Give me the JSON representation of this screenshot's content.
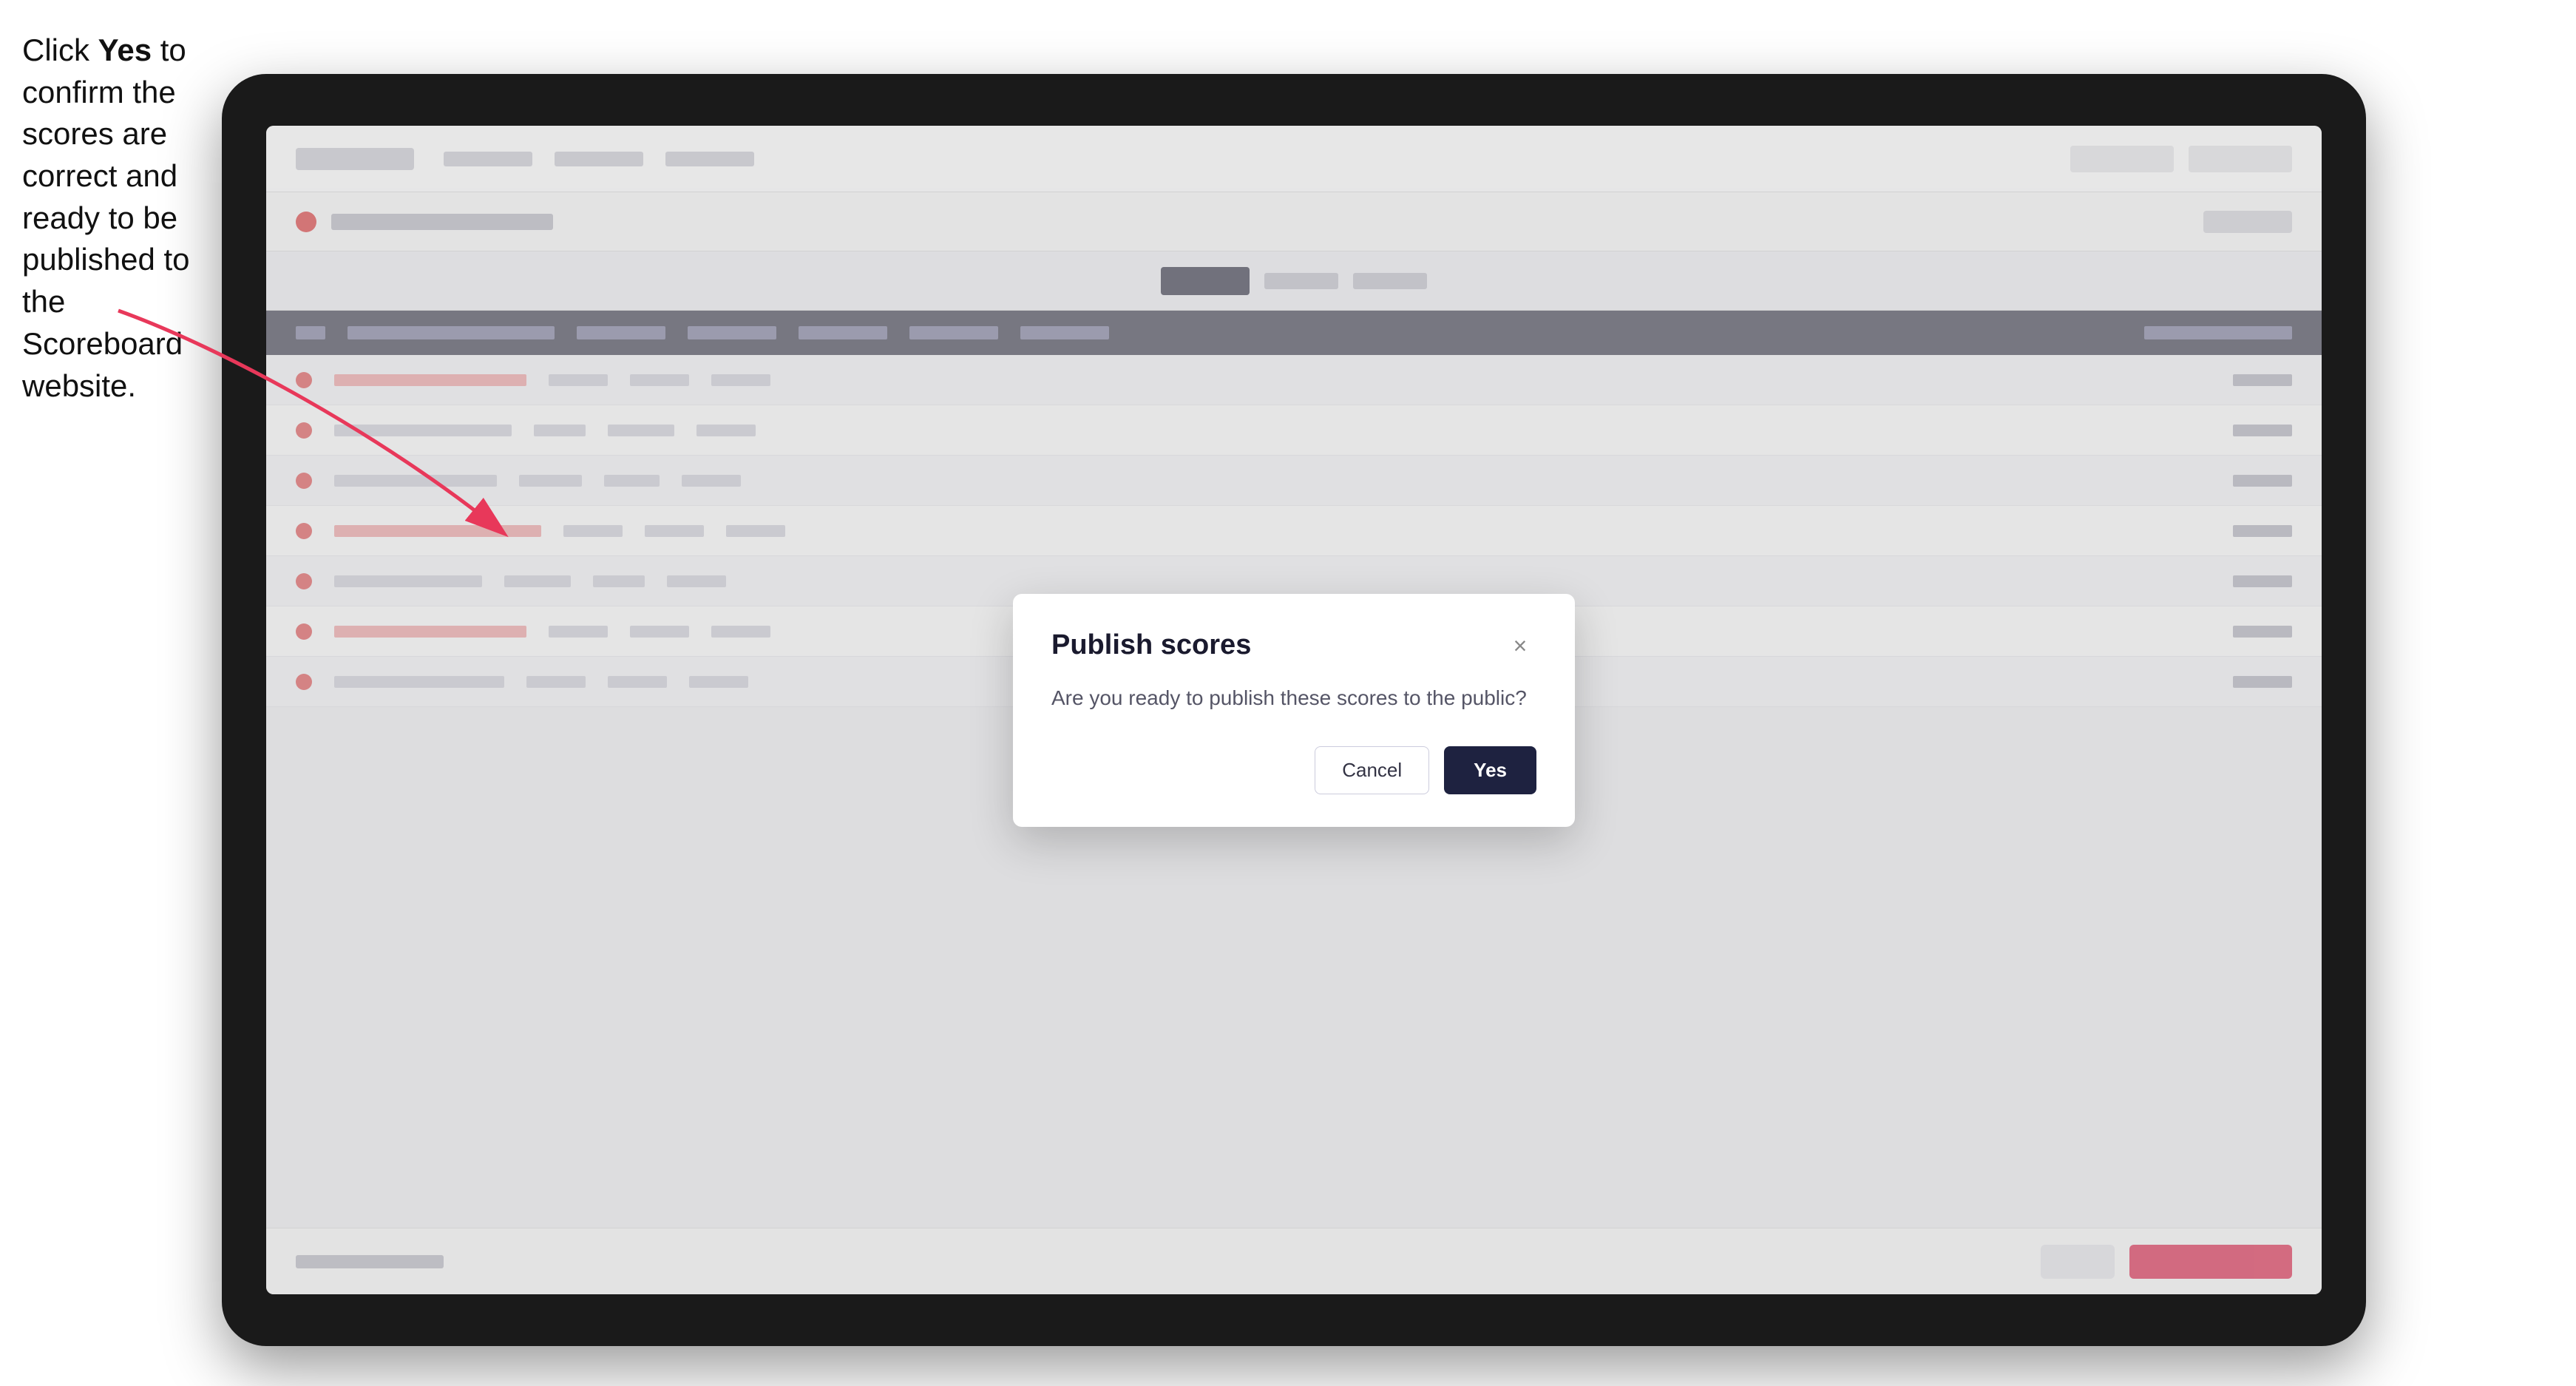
{
  "instruction": {
    "text_part1": "Click ",
    "bold_text": "Yes",
    "text_part2": " to confirm the scores are correct and ready to be published to the Scoreboard website."
  },
  "modal": {
    "title": "Publish scores",
    "body_text": "Are you ready to publish these scores to the public?",
    "cancel_label": "Cancel",
    "yes_label": "Yes",
    "close_icon": "×"
  },
  "table": {
    "rows": [
      {
        "id": 1
      },
      {
        "id": 2
      },
      {
        "id": 3
      },
      {
        "id": 4
      },
      {
        "id": 5
      },
      {
        "id": 6
      },
      {
        "id": 7
      }
    ]
  },
  "colors": {
    "yes_button_bg": "#1e2240",
    "close_button_color": "#888888",
    "arrow_color": "#e8385a"
  }
}
